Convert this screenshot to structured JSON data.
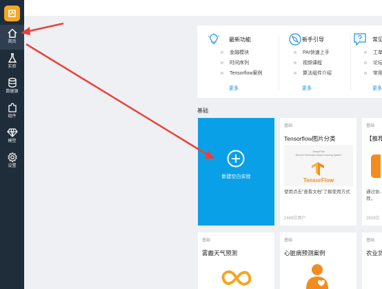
{
  "sidebar": {
    "items": [
      {
        "label": "首页",
        "icon": "home-icon"
      },
      {
        "label": "实验",
        "icon": "flask-icon"
      },
      {
        "label": "数据源",
        "icon": "database-icon"
      },
      {
        "label": "组件",
        "icon": "puzzle-icon"
      },
      {
        "label": "模型",
        "icon": "diamond-icon"
      },
      {
        "label": "设置",
        "icon": "gear-icon"
      }
    ]
  },
  "features": [
    {
      "title": "最新功能",
      "icon": "lightbulb-icon",
      "items": [
        "金融模块",
        "时间序列",
        "Tensorflow案例"
      ],
      "more": "更多"
    },
    {
      "title": "新手引导",
      "icon": "compass-icon",
      "items": [
        "PAI快速上手",
        "视频课程",
        "算法组件介绍"
      ],
      "more": "更多"
    },
    {
      "title": "常见",
      "icon": "question-icon",
      "items": [
        "工单",
        "论坛",
        "常用"
      ],
      "more": "更多"
    }
  ],
  "section": {
    "title": "基础"
  },
  "new_experiment": {
    "label": "新建空白实验"
  },
  "cards": [
    {
      "tag": "基础",
      "title": "Tensorflow图片分类",
      "thumb_line1": "TensorFlow",
      "thumb_line2": "Second Generation Deep Learning System",
      "thumb_name": "TensorFlow",
      "desc": "使用点击\"查看文档\"了解使用方式",
      "users": "2489位用户"
    },
    {
      "tag": "基础",
      "title": "【推荐",
      "desc": "通过协…",
      "desc2": "荐。",
      "users": "2833位"
    },
    {
      "tag": "基础",
      "title": "雾霾天气预测"
    },
    {
      "tag": "基础",
      "title": "心脏病预测案例"
    },
    {
      "tag": "基础",
      "title": "农业贷"
    }
  ],
  "colors": {
    "sidebar": "#1f2c3a",
    "accent": "#0aa0e8",
    "orange": "#f28c1e",
    "arrow": "#e8413a"
  }
}
